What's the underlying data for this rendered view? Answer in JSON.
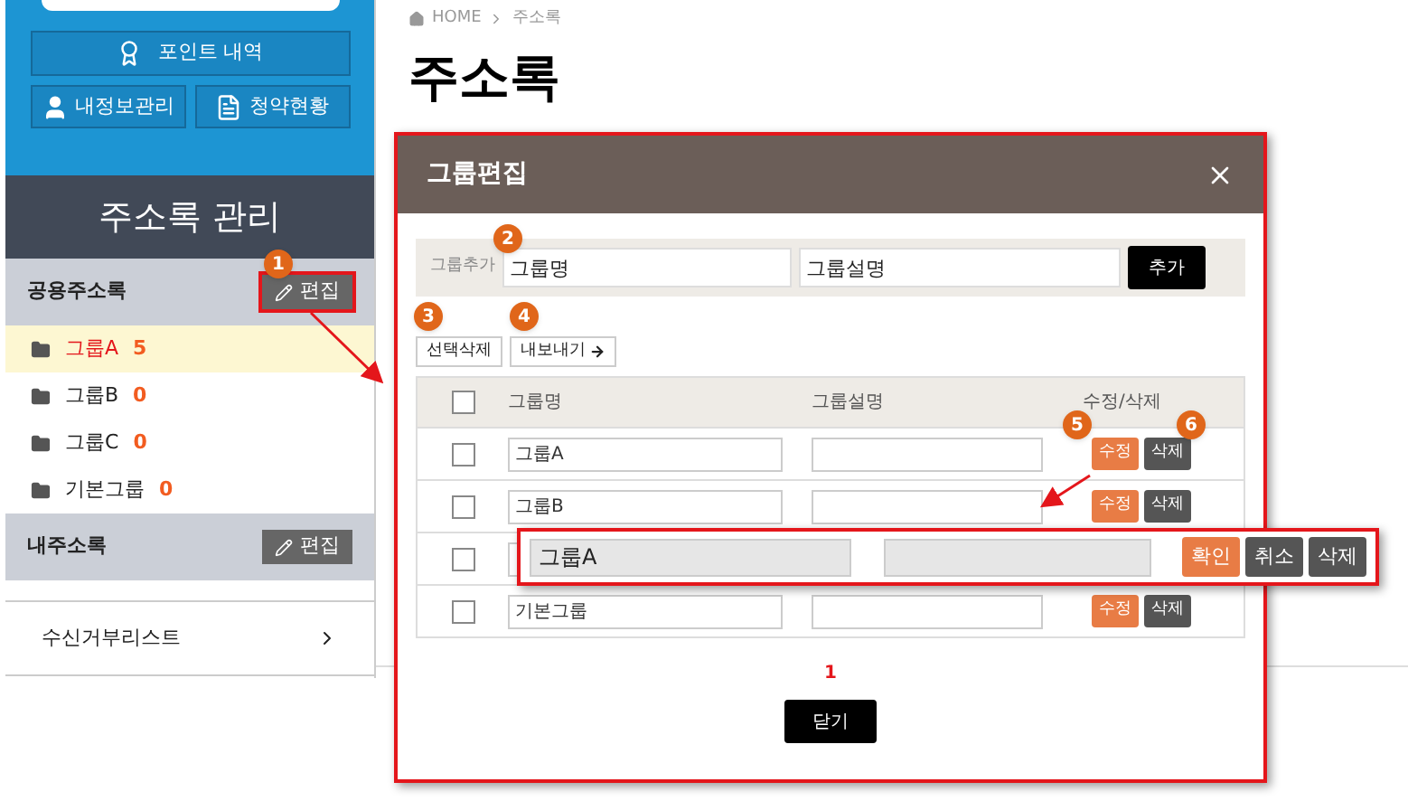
{
  "sidebar": {
    "top_buttons": [
      {
        "label": "포인트 내역"
      },
      {
        "label": "내정보관리"
      },
      {
        "label": "청약현황"
      }
    ],
    "title": "주소록 관리",
    "sections": [
      {
        "title": "공용주소록",
        "edit_label": "편집",
        "highlighted": true
      },
      {
        "title": "내주소록",
        "edit_label": "편집",
        "highlighted": false
      }
    ],
    "groups": [
      {
        "name": "그룹A",
        "count": "5",
        "selected": true
      },
      {
        "name": "그룹B",
        "count": "0",
        "selected": false
      },
      {
        "name": "그룹C",
        "count": "0",
        "selected": false
      },
      {
        "name": "기본그룹",
        "count": "0",
        "selected": false
      }
    ],
    "link": "수신거부리스트"
  },
  "breadcrumb": {
    "home": "HOME",
    "current": "주소록"
  },
  "page_title": "주소록",
  "modal": {
    "title": "그룹편집",
    "add_label": "그룹추가",
    "name_value": "그룹명",
    "desc_value": "그룹설명",
    "add_button": "추가",
    "actions": [
      "선택삭제",
      "내보내기"
    ],
    "columns": [
      "그룹명",
      "그룹설명",
      "수정/삭제"
    ],
    "header_checked": false,
    "rows": [
      {
        "name": "그룹A",
        "checked": false,
        "edit": "수정",
        "delete": "삭제"
      },
      {
        "name": "그룹B",
        "checked": false,
        "edit": "수정",
        "delete": "삭제"
      },
      {
        "checked": false
      },
      {
        "name": "기본그룹",
        "checked": false,
        "edit": "수정",
        "delete": "삭제"
      }
    ],
    "page": "1",
    "close_button": "닫기"
  },
  "edit_popup": {
    "name": "그룹A",
    "buttons": [
      {
        "label": "확인",
        "kind": "primary"
      },
      {
        "label": "취소",
        "kind": "dark"
      },
      {
        "label": "삭제",
        "kind": "dark"
      }
    ]
  },
  "markers": [
    "1",
    "2",
    "3",
    "4",
    "5",
    "6"
  ]
}
